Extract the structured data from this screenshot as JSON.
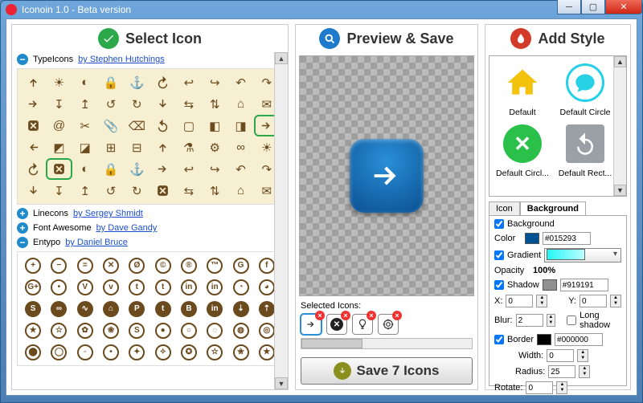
{
  "window": {
    "title": "Iconoin 1.0 - Beta version"
  },
  "headers": {
    "select": "Select Icon",
    "preview": "Preview & Save",
    "style": "Add Style"
  },
  "iconsets": {
    "typeicons": {
      "name": "TypeIcons",
      "author": "by Stephen Hutchings",
      "expanded": true
    },
    "linecons": {
      "name": "Linecons",
      "author": "by Sergey Shmidt",
      "expanded": false
    },
    "fontawesome": {
      "name": "Font Awesome",
      "author": "by Dave Gandy",
      "expanded": false
    },
    "entypo": {
      "name": "Entypo",
      "author": "by Daniel Bruce",
      "expanded": true
    }
  },
  "selected_grid_indices": {
    "typeicons_arrow_right": 29,
    "typeicons_x_box": 41
  },
  "preview": {
    "selected_label": "Selected Icons:",
    "selected": [
      {
        "icon": "arrow-right",
        "active": true
      },
      {
        "icon": "x-circle"
      },
      {
        "icon": "bulb"
      },
      {
        "icon": "target"
      }
    ],
    "save_label": "Save 7 Icons",
    "save_count": 7
  },
  "styles": {
    "cards": [
      {
        "id": "default",
        "label": "Default"
      },
      {
        "id": "default-circle",
        "label": "Default Circle"
      },
      {
        "id": "default-circle-2",
        "label": "Default Circl..."
      },
      {
        "id": "default-rect",
        "label": "Default Rect..."
      }
    ],
    "tabs": {
      "icon": "Icon",
      "background": "Background",
      "active": "background"
    },
    "background": {
      "bg_checked": true,
      "bg_label": "Background",
      "color_label": "Color",
      "color": "#015293",
      "gradient_checked": true,
      "gradient_label": "Gradient",
      "opacity_label": "Opacity",
      "opacity": "100%",
      "shadow_checked": true,
      "shadow_label": "Shadow",
      "shadow_color": "#919191",
      "x_label": "X:",
      "x": "0",
      "y_label": "Y:",
      "y": "0",
      "blur_label": "Blur:",
      "blur": "2",
      "long_shadow_checked": false,
      "long_shadow_label": "Long shadow",
      "border_checked": true,
      "border_label": "Border",
      "border_color": "#000000",
      "width_label": "Width:",
      "width": "0",
      "radius_label": "Radius:",
      "radius": "25",
      "rotate_label": "Rotate:",
      "rotate": "0"
    }
  },
  "colors": {
    "brown": "#6b4a1d",
    "accent_blue": "#1f7acc",
    "accent_green": "#2aa84a",
    "accent_red": "#d43a2a",
    "tile_bg": "#015293"
  }
}
